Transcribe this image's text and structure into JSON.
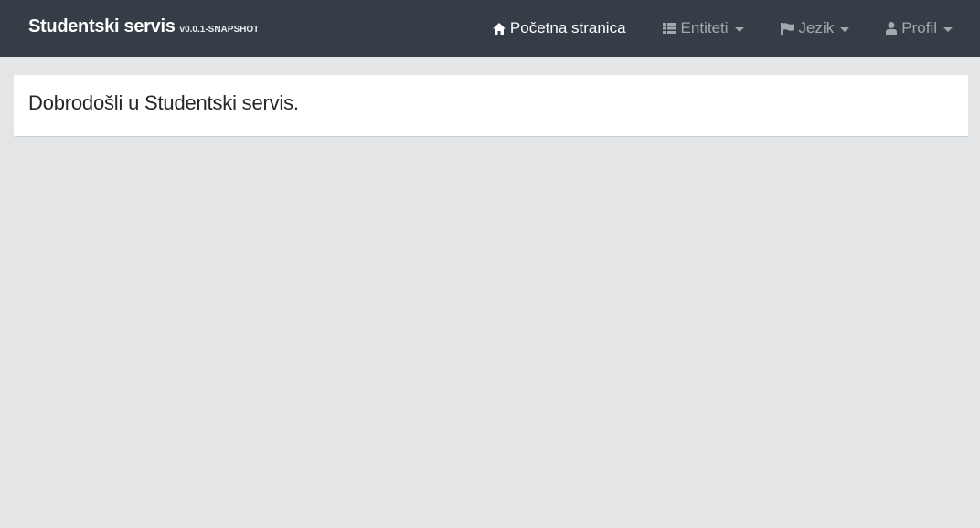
{
  "navbar": {
    "brand": {
      "name": "Studentski servis",
      "version": "v0.0.1-SNAPSHOT"
    },
    "items": [
      {
        "label": "Početna stranica",
        "icon": "home-icon",
        "active": true,
        "dropdown": false
      },
      {
        "label": "Entiteti",
        "icon": "list-icon",
        "active": false,
        "dropdown": true
      },
      {
        "label": "Jezik",
        "icon": "flag-icon",
        "active": false,
        "dropdown": true
      },
      {
        "label": "Profil",
        "icon": "user-icon",
        "active": false,
        "dropdown": true
      }
    ]
  },
  "main": {
    "welcome_text": "Dobrodošli u Studentski servis."
  },
  "colors": {
    "navbar_bg": "#353d47",
    "page_bg": "#e4e5e6",
    "card_bg": "#ffffff"
  }
}
